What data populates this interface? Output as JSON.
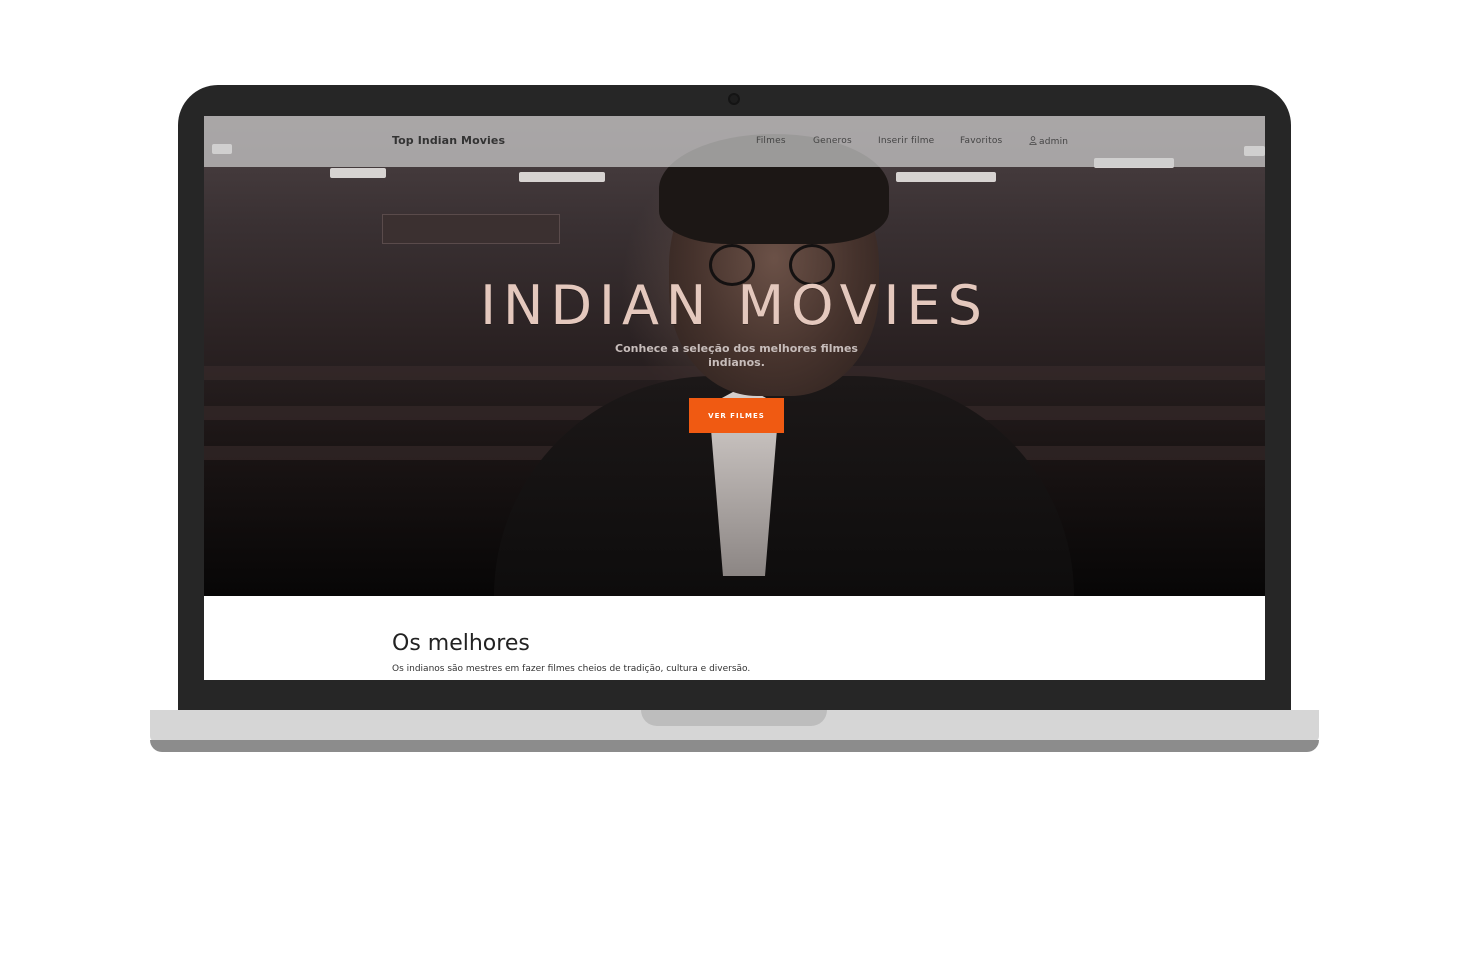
{
  "nav": {
    "brand": "Top Indian Movies",
    "links": [
      "Filmes",
      "Generos",
      "Inserir filme",
      "Favoritos"
    ],
    "user": "admin"
  },
  "hero": {
    "title": "INDIAN MOVIES",
    "subtitle": "Conhece a seleção dos melhores filmes indianos.",
    "button": "VER FILMES"
  },
  "section": {
    "title": "Os melhores",
    "text": "Os indianos são mestres em fazer filmes cheios de tradição, cultura e diversão."
  },
  "colors": {
    "accent": "#f05a12",
    "laptop_frame": "#262626"
  }
}
